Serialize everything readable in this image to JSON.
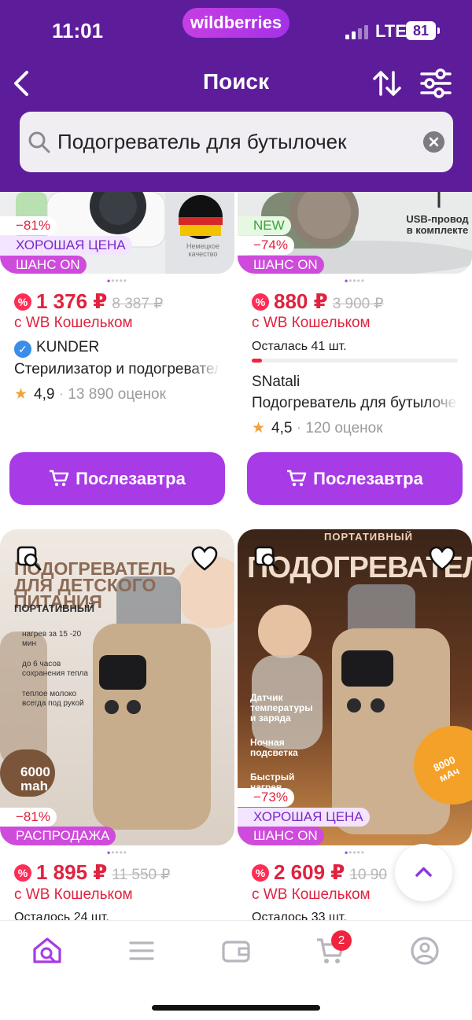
{
  "status_bar": {
    "time": "11:01",
    "network": "LTE",
    "battery": "81"
  },
  "brand": "wildberries",
  "header": {
    "title": "Поиск",
    "back_icon": "chevron-left-icon",
    "sort_icon": "sort-arrows-icon",
    "filter_icon": "sliders-icon"
  },
  "search": {
    "value": "Подогреватель для бутылочек"
  },
  "colors": {
    "header": "#5d1d9b",
    "accent": "#a73be6",
    "price": "#e0223f",
    "badge_on": "#cf4bdc"
  },
  "products": [
    {
      "badges": [
        "−81%",
        "ХОРОШАЯ ЦЕНА",
        "ШАНС ON"
      ],
      "image_text": [
        "Немецкое качество"
      ],
      "price": "1 376 ₽",
      "old_price": "8 387 ₽",
      "wallet": "с WB Кошельком",
      "brand": "KUNDER",
      "name": "Стерилизатор и подогреватель",
      "rating": "4,9",
      "reviews": "13 890 оценок",
      "button": "Послезавтра"
    },
    {
      "badges": [
        "NEW",
        "−74%",
        "ШАНС ON"
      ],
      "image_text": [
        "USB-провод в комплекте"
      ],
      "price": "880 ₽",
      "old_price": "3 900 ₽",
      "wallet": "с WB Кошельком",
      "stock": "Осталась 41 шт.",
      "stock_level": 0.05,
      "brand": "SNatali",
      "name": "Подогреватель для бутылочек",
      "rating": "4,5",
      "reviews": "120 оценок",
      "button": "Послезавтра"
    },
    {
      "badges": [
        "−81%",
        "РАСПРОДАЖА"
      ],
      "image_text": [
        "ПОДОГРЕВАТЕЛЬ",
        "ДЛЯ ДЕТСКОГО",
        "ПИТАНИЯ",
        "ПОРТАТИВНЫЙ",
        "нагрев за 15 -20 мин",
        "до 6 часов сохранения тепла",
        "теплое молоко всегда под рукой",
        "6000 mah"
      ],
      "price": "1 895 ₽",
      "old_price": "11 550 ₽",
      "wallet": "с WB Кошельком",
      "stock": "Осталось 24 шт."
    },
    {
      "badges": [
        "−73%",
        "ХОРОШАЯ ЦЕНА",
        "ШАНС ON"
      ],
      "image_text": [
        "ПОРТАТИВНЫЙ",
        "ПОДОГРЕВАТЕЛЬ",
        "Датчик температуры и заряда",
        "Ночная подсветка",
        "Быстрый нагрев",
        "8000 мАч"
      ],
      "price": "2 609 ₽",
      "old_price": "10 90",
      "wallet": "с WB Кошельком",
      "stock": "Осталось 33 шт."
    }
  ],
  "bottom_nav": {
    "tabs": [
      "home-search-icon",
      "catalog-icon",
      "wallet-icon",
      "cart-icon",
      "profile-icon"
    ],
    "cart_count": "2"
  }
}
